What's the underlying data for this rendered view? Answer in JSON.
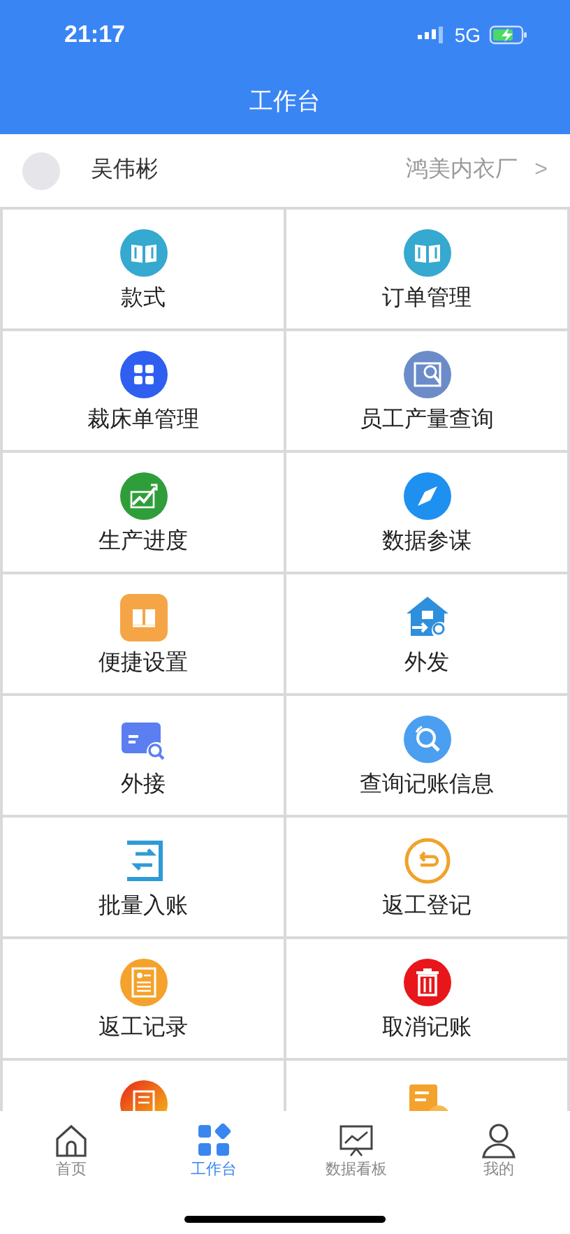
{
  "status_bar": {
    "time": "21:17",
    "network": "5G"
  },
  "header": {
    "title": "工作台"
  },
  "user": {
    "name": "吴伟彬",
    "company": "鸿美内衣厂",
    "chevron": ">"
  },
  "tiles": [
    {
      "kind": "tile",
      "label": "款式"
    },
    {
      "kind": "tile",
      "label": "订单管理"
    },
    {
      "kind": "tile",
      "label": "裁床单管理"
    },
    {
      "kind": "tile",
      "label": "员工产量查询"
    },
    {
      "kind": "tile",
      "label": "生产进度"
    },
    {
      "kind": "tile",
      "label": "数据参谋"
    },
    {
      "kind": "tile",
      "label": "便捷设置"
    },
    {
      "kind": "tile",
      "label": "外发"
    },
    {
      "kind": "tile",
      "label": "外接"
    },
    {
      "kind": "tile",
      "label": "查询记账信息"
    },
    {
      "kind": "tile",
      "label": "批量入账"
    },
    {
      "kind": "tile",
      "label": "返工登记"
    },
    {
      "kind": "tile",
      "label": "返工记录"
    },
    {
      "kind": "tile",
      "label": "取消记账"
    },
    {
      "kind": "partial"
    },
    {
      "kind": "partial"
    }
  ],
  "tab_bar": [
    {
      "label": "首页",
      "selected": false
    },
    {
      "label": "工作台",
      "selected": true
    },
    {
      "label": "数据看板",
      "selected": false
    },
    {
      "label": "我的",
      "selected": false
    }
  ]
}
